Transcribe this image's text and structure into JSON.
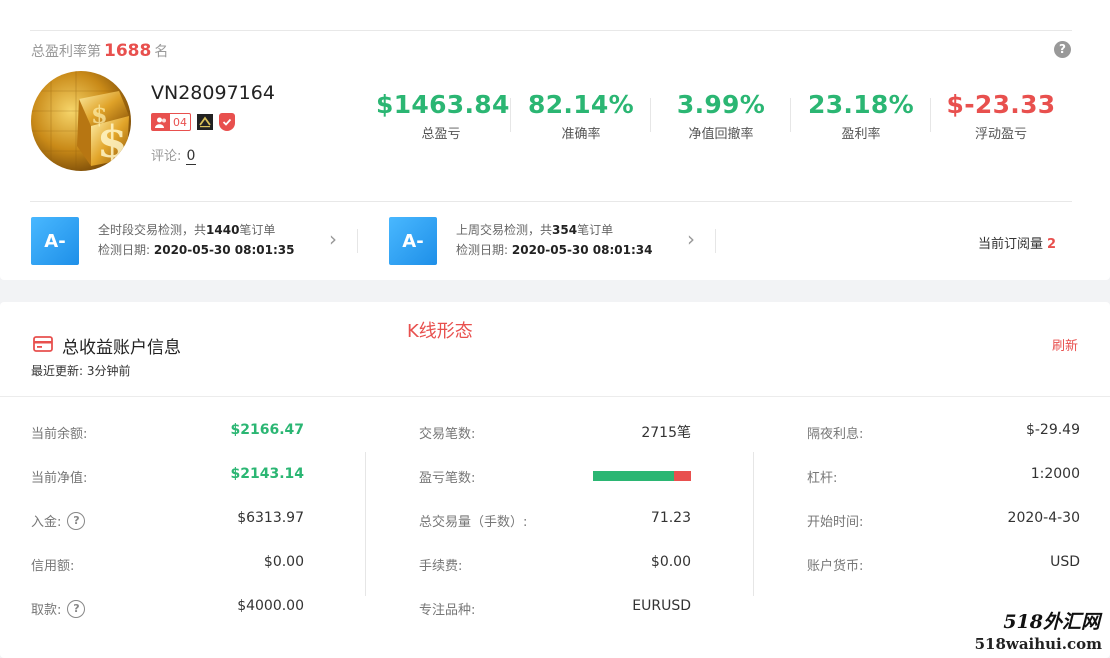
{
  "rank": {
    "prefix": "总盈利率第",
    "number": "1688",
    "suffix": "名"
  },
  "help_glyph": "?",
  "account": {
    "name": "VN28097164",
    "badge_level": "04",
    "comment_label": "评论:",
    "comment_count": "0"
  },
  "stats": [
    {
      "value": "$1463.84",
      "label": "总盈亏",
      "negative": false
    },
    {
      "value": "82.14%",
      "label": "准确率",
      "negative": false
    },
    {
      "value": "3.99%",
      "label": "净值回撤率",
      "negative": false
    },
    {
      "value": "23.18%",
      "label": "盈利率",
      "negative": false
    },
    {
      "value": "$-23.33",
      "label": "浮动盈亏",
      "negative": true
    }
  ],
  "detections": [
    {
      "grade": "A-",
      "line1_prefix": "全时段交易检测，共",
      "count": "1440",
      "line1_suffix": "笔订单",
      "date_label": "检测日期:",
      "date": "2020-05-30 08:01:35"
    },
    {
      "grade": "A-",
      "line1_prefix": "上周交易检测，共",
      "count": "354",
      "line1_suffix": "笔订单",
      "date_label": "检测日期:",
      "date": "2020-05-30 08:01:34"
    }
  ],
  "subscription": {
    "label": "当前订阅量",
    "count": "2"
  },
  "section": {
    "title": "总收益账户信息",
    "updated_label": "最近更新:",
    "updated_value": "3分钟前",
    "refresh": "刷新",
    "annotation": "K线形态"
  },
  "columns": [
    [
      {
        "label": "当前余额:",
        "value": "$2166.47",
        "green": true
      },
      {
        "label": "当前净值:",
        "value": "$2143.14",
        "green": true
      },
      {
        "label": "入金:",
        "value": "$6313.97",
        "help": true
      },
      {
        "label": "信用额:",
        "value": "$0.00"
      },
      {
        "label": "取款:",
        "value": "$4000.00",
        "help": true
      }
    ],
    [
      {
        "label": "交易笔数:",
        "value": "2715笔"
      },
      {
        "label": "盈亏笔数:",
        "value": ""
      },
      {
        "label": "总交易量（手数）:",
        "value": "71.23"
      },
      {
        "label": "手续费:",
        "value": "$0.00"
      },
      {
        "label": "专注品种:",
        "value": "EURUSD"
      }
    ],
    [
      {
        "label": "隔夜利息:",
        "value": "$-29.49"
      },
      {
        "label": "杠杆:",
        "value": "1:2000"
      },
      {
        "label": "开始时间:",
        "value": "2020-4-30"
      },
      {
        "label": "账户货币:",
        "value": "USD"
      }
    ]
  ],
  "win_loss_ratio": 0.83,
  "colors": {
    "profit": "#2bb673",
    "loss": "#e8504e",
    "grade": "#2a9af0"
  },
  "watermark": {
    "line1": "518外汇网",
    "line2": "518waihui.com"
  }
}
